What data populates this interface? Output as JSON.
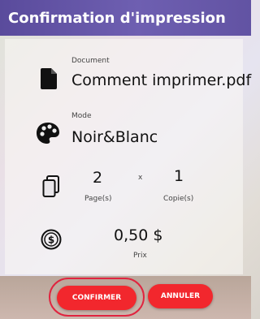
{
  "title": "Confirmation d'impression",
  "document": {
    "label": "Document",
    "value": "Comment imprimer.pdf",
    "icon": "document-icon"
  },
  "mode": {
    "label": "Mode",
    "value": "Noir&Blanc",
    "icon": "palette-icon"
  },
  "pages": {
    "value": "2",
    "label": "Page(s)",
    "icon": "pages-icon"
  },
  "multiply": "x",
  "copies": {
    "value": "1",
    "label": "Copie(s)"
  },
  "price": {
    "value": "0,50 $",
    "label": "Prix",
    "icon": "dollar-icon"
  },
  "buttons": {
    "confirm": "CONFIRMER",
    "cancel": "ANNULER"
  },
  "colors": {
    "header": "#6253a3",
    "button": "#f2272d"
  }
}
